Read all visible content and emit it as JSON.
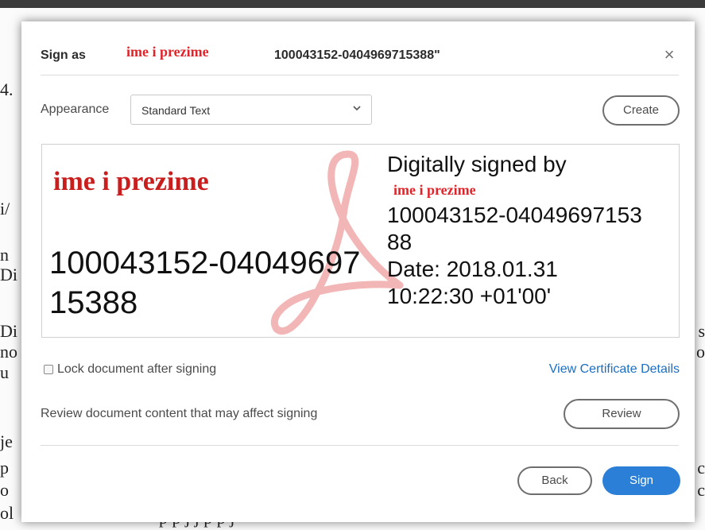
{
  "background_document": {
    "left_fragments": [
      "4.",
      "i/",
      "n",
      "Di",
      "Di",
      "no",
      "u",
      "je",
      "p",
      "o",
      "ol"
    ],
    "right_fragments": [
      "s",
      "o",
      "c",
      "c"
    ],
    "bottom_fragment": "p                         p        j    j        p        p    j"
  },
  "dialog": {
    "header": {
      "sign_as_label": "Sign as",
      "signer_name": "ime i prezime",
      "signer_id_suffix": "100043152-0404969715388\"",
      "close_symbol": "×"
    },
    "appearance": {
      "label": "Appearance",
      "selected": "Standard Text",
      "chevron": "⌄",
      "create_label": "Create"
    },
    "preview": {
      "left_name": "ime i prezime",
      "left_id": "100043152-0404969715388",
      "right_lines": {
        "digitally_signed_by": "Digitally signed by",
        "name": "ime i prezime",
        "id_line1": "100043152-04049697153",
        "id_line2": "88",
        "date_line": "Date: 2018.01.31",
        "time_line": "10:22:30 +01'00'"
      }
    },
    "options": {
      "lock_label": "Lock document after signing",
      "lock_checked": false,
      "view_cert_link": "View Certificate Details",
      "review_text": "Review document content that may affect signing",
      "review_button": "Review"
    },
    "footer": {
      "back_label": "Back",
      "sign_label": "Sign"
    }
  },
  "colors": {
    "accent_blue": "#2c7fd6",
    "link_blue": "#1a6fc4",
    "name_red": "#e0242a",
    "logo_pink": "#f3b6b6"
  }
}
